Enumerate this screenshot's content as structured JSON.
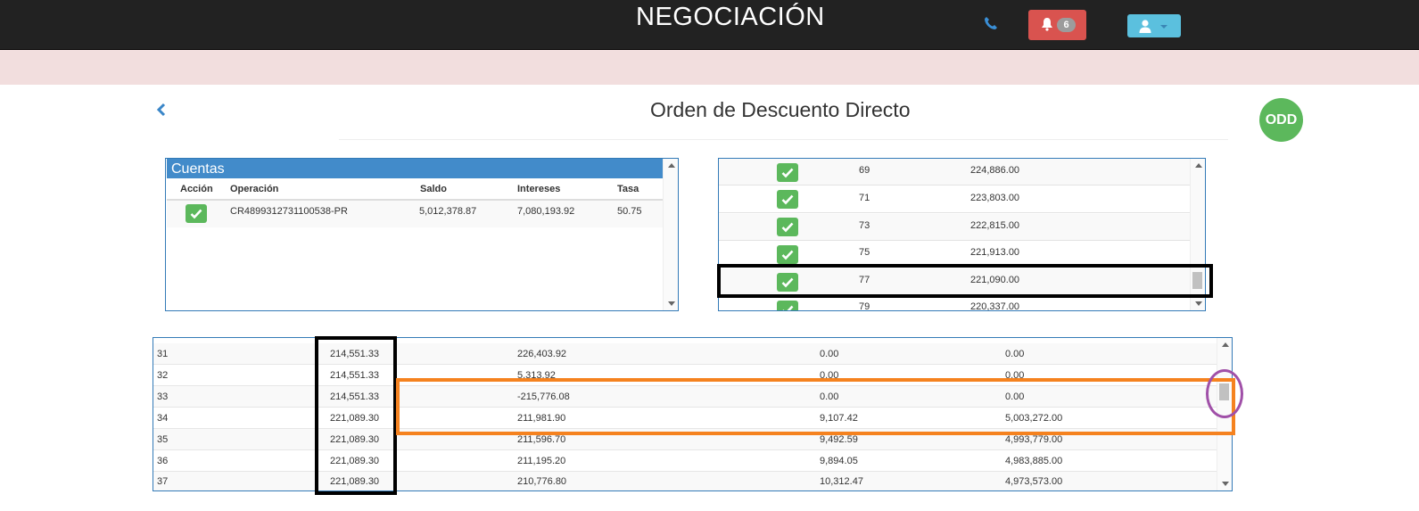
{
  "header": {
    "title": "NEGOCIACIÓN",
    "notifications_count": "6",
    "icons": [
      "phone-icon",
      "bell-icon",
      "user-icon",
      "caret-down-icon"
    ]
  },
  "page": {
    "title": "Orden de Descuento Directo",
    "badge": "ODD"
  },
  "cuentas": {
    "title": "Cuentas",
    "columns": [
      "Acción",
      "Operación",
      "Saldo",
      "Intereses",
      "Tasa"
    ],
    "rows": [
      {
        "operacion": "CR4899312731100538-PR",
        "saldo": "5,012,378.87",
        "intereses": "7,080,193.92",
        "tasa": "50.75"
      }
    ]
  },
  "payments": {
    "rows": [
      {
        "n": "69",
        "amount": "224,886.00"
      },
      {
        "n": "71",
        "amount": "223,803.00"
      },
      {
        "n": "73",
        "amount": "222,815.00"
      },
      {
        "n": "75",
        "amount": "221,913.00"
      },
      {
        "n": "77",
        "amount": "221,090.00"
      },
      {
        "n": "79",
        "amount": "220,337.00"
      }
    ]
  },
  "schedule": {
    "rows": [
      {
        "n": "31",
        "cuota": "214,551.33",
        "c3": "226,403.92",
        "c4": "0.00",
        "c5": "0.00"
      },
      {
        "n": "32",
        "cuota": "214,551.33",
        "c3": "5,313.92",
        "c4": "0.00",
        "c5": "0.00"
      },
      {
        "n": "33",
        "cuota": "214,551.33",
        "c3": "-215,776.08",
        "c4": "0.00",
        "c5": "0.00"
      },
      {
        "n": "34",
        "cuota": "221,089.30",
        "c3": "211,981.90",
        "c4": "9,107.42",
        "c5": "5,003,272.00"
      },
      {
        "n": "35",
        "cuota": "221,089.30",
        "c3": "211,596.70",
        "c4": "9,492.59",
        "c5": "4,993,779.00"
      },
      {
        "n": "36",
        "cuota": "221,089.30",
        "c3": "211,195.20",
        "c4": "9,894.05",
        "c5": "4,983,885.00"
      },
      {
        "n": "37",
        "cuota": "221,089.30",
        "c3": "210,776.80",
        "c4": "10,312.47",
        "c5": "4,973,573.00"
      }
    ]
  },
  "colors": {
    "topbar": "#222222",
    "alert_band": "#f2dede",
    "danger": "#d9534f",
    "info": "#5bc0de",
    "success": "#5cb85c",
    "primary": "#428bca",
    "highlight_black": "#000000",
    "highlight_orange": "#f5821f",
    "highlight_purple": "#a050a8"
  }
}
